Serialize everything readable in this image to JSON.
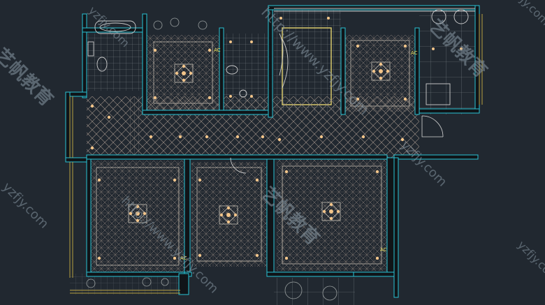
{
  "plan": {
    "ac_labels": [
      "AC",
      "AC",
      "AC",
      "AC"
    ],
    "colors": {
      "background": "#212830",
      "wall": "#29c4d6",
      "wall_fill": "#101418",
      "ceiling_grid": "#8a8f96",
      "herringbone": "#9c8f86",
      "light": "#f3c58a",
      "ac_text": "#e8e060",
      "yellow_line": "#b8a040",
      "fixture": "#c9c9c9"
    }
  },
  "watermark": {
    "url_short": "yzfjy.com",
    "url_long": "http://www.yzfjy.com",
    "cn_text": "艺帆教育"
  }
}
